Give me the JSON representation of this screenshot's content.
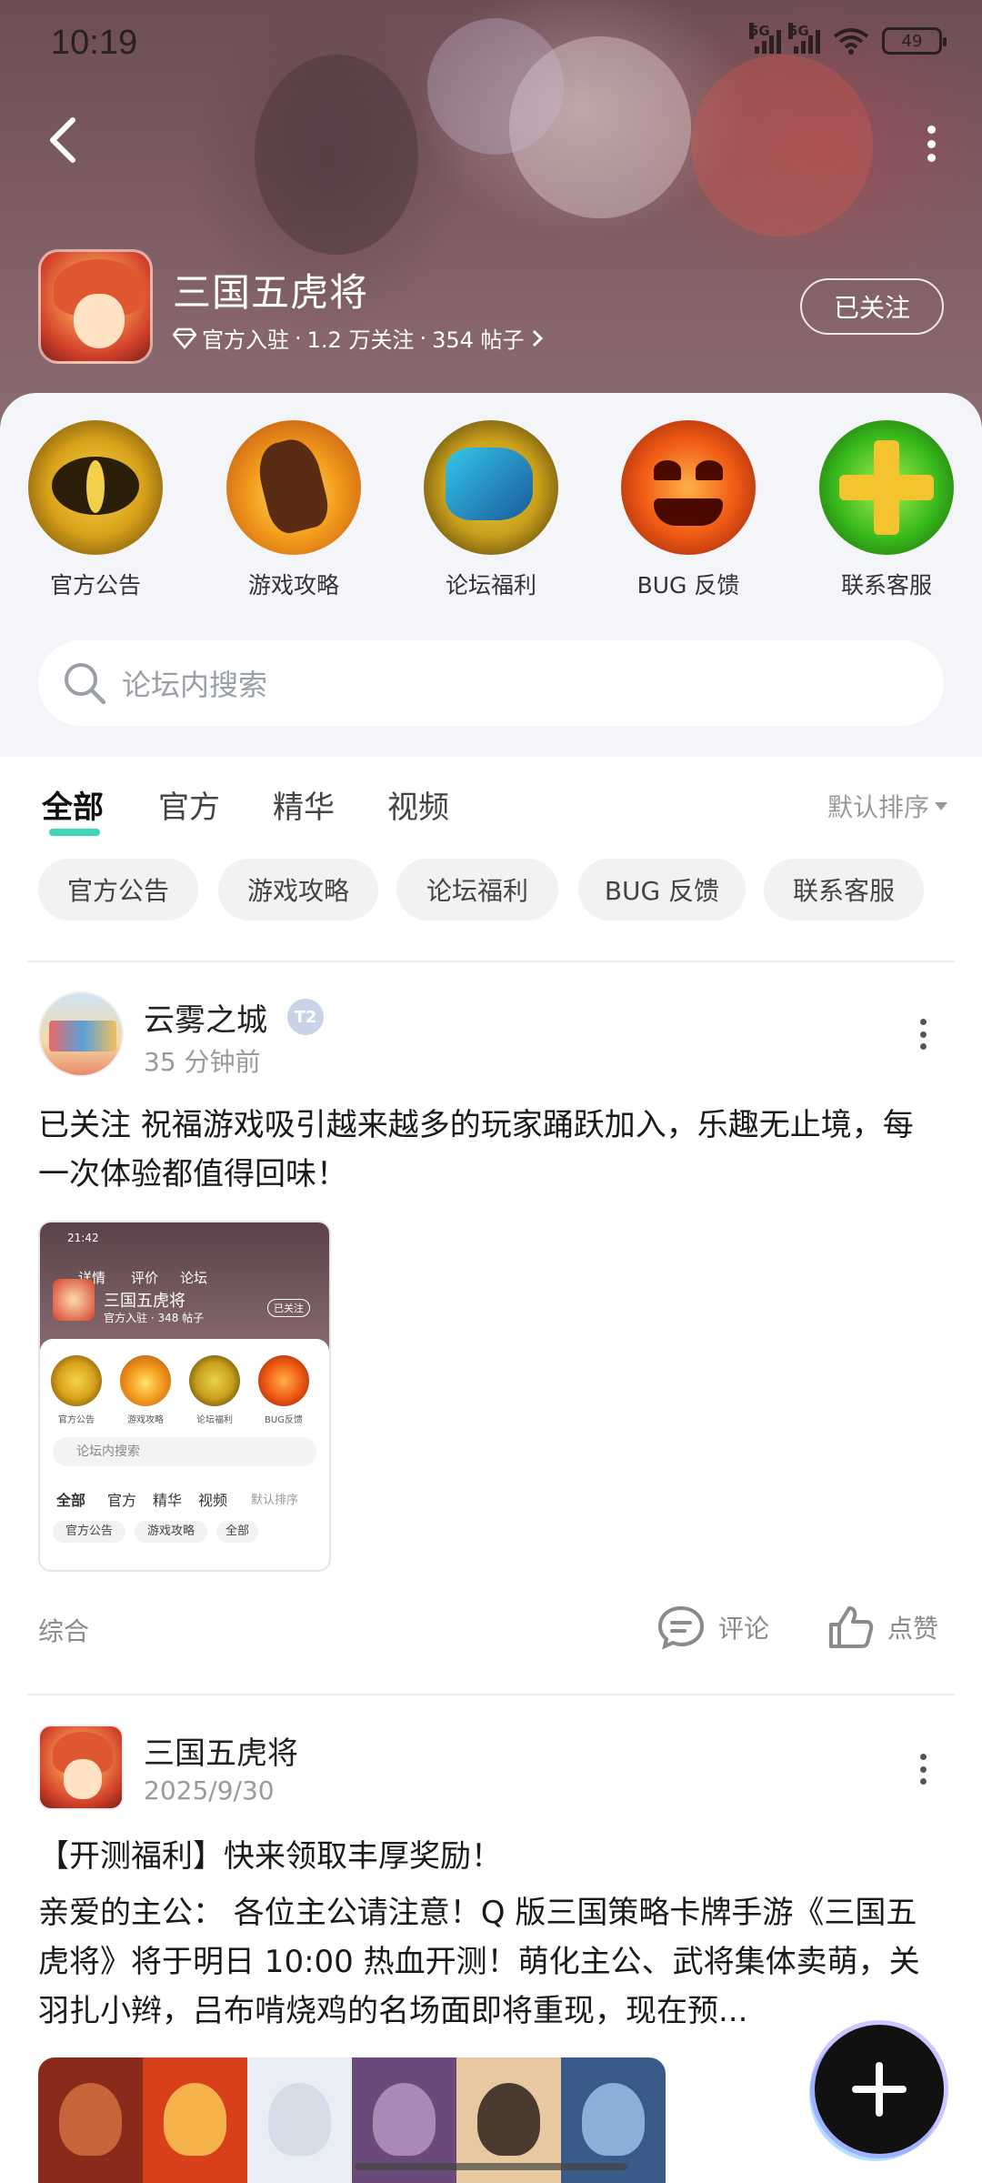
{
  "status_bar": {
    "time": "10:19",
    "signal1": "5G",
    "signal2": "5G",
    "battery": "49"
  },
  "header": {
    "game_title": "三国五虎将",
    "meta_verified": "官方入驻",
    "meta_sep1": "·",
    "meta_followers": "1.2 万关注",
    "meta_sep2": "·",
    "meta_posts": "354 帖子",
    "follow_button": "已关注"
  },
  "categories": [
    {
      "label": "官方公告",
      "icon": "cat-eye-icon"
    },
    {
      "label": "游戏攻略",
      "icon": "hand-icon"
    },
    {
      "label": "论坛福利",
      "icon": "fist-icon"
    },
    {
      "label": "BUG 反馈",
      "icon": "pumpkin-icon"
    },
    {
      "label": "联系客服",
      "icon": "plus-icon"
    }
  ],
  "search": {
    "placeholder": "论坛内搜索"
  },
  "tabs": [
    {
      "label": "全部",
      "active": true
    },
    {
      "label": "官方",
      "active": false
    },
    {
      "label": "精华",
      "active": false
    },
    {
      "label": "视频",
      "active": false
    }
  ],
  "sort_label": "默认排序",
  "chips": [
    "官方公告",
    "游戏攻略",
    "论坛福利",
    "BUG 反馈",
    "联系客服"
  ],
  "posts": [
    {
      "author": "云雾之城",
      "time": "35 分钟前",
      "badge": "T2",
      "text": "已关注  祝福游戏吸引越来越多的玩家踊跃加入，乐趣无止境，每一次体验都值得回味！",
      "thumbnail": {
        "time": "21:42",
        "nav": [
          "详情",
          "评价",
          "论坛"
        ],
        "title": "三国五虎将",
        "meta": "官方入驻 · 348 帖子",
        "follow": "已关注",
        "cats": [
          "官方公告",
          "游戏攻略",
          "论坛福利",
          "BUG反馈"
        ],
        "search": "论坛内搜索",
        "tabs": [
          "全部",
          "官方",
          "精华",
          "视频"
        ],
        "sort": "默认排序",
        "chips": [
          "官方公告",
          "游戏攻略",
          "全部"
        ]
      },
      "category": "综合",
      "comment_label": "评论",
      "like_label": "点赞"
    },
    {
      "author": "三国五虎将",
      "time": "2025/9/30",
      "title": "【开测福利】快来领取丰厚奖励！",
      "text": "亲爱的主公：  各位主公请注意！Q 版三国策略卡牌手游《三国五虎将》将于明日 10:00 热血开测！萌化主公、武将集体卖萌，关羽扎小辫，吕布啃烧鸡的名场面即将重现，现在预..."
    }
  ],
  "colors": {
    "accent": "#3ed6b6",
    "hero": "#7a5a5f",
    "panel": "#f3f5f8"
  }
}
